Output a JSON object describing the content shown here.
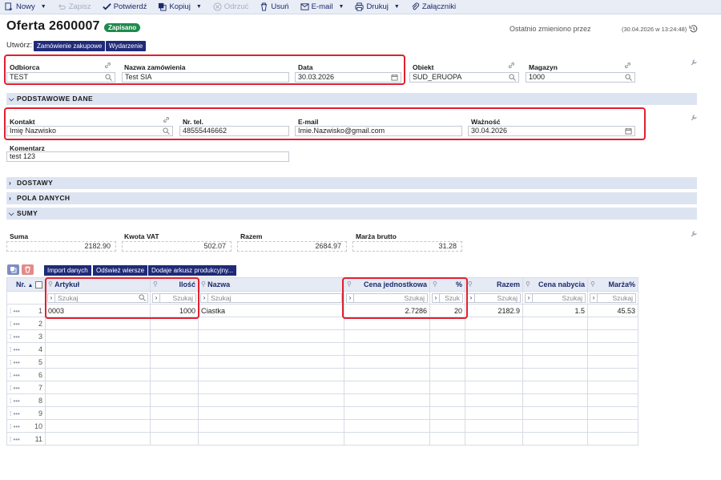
{
  "toolbar": {
    "new": "Nowy",
    "save": "Zapisz",
    "confirm": "Potwierdź",
    "copy": "Kopiuj",
    "reject": "Odrzuć",
    "delete": "Usuń",
    "email": "E-mail",
    "print": "Drukuj",
    "attachments": "Załączniki"
  },
  "header": {
    "title": "Oferta 2600007",
    "status": "Zapisano",
    "last_modified_label": "Ostatnio zmieniono przez",
    "last_modified_date": "(30.04.2026 w 13:24:48)"
  },
  "create": {
    "label": "Utwórz:",
    "purchase_order": "Zamówienie zakupowe",
    "event": "Wydarzenie"
  },
  "fields": {
    "recipient_label": "Odbiorca",
    "recipient_value": "TEST",
    "order_name_label": "Nazwa zamówienia",
    "order_name_value": "Test SIA",
    "date_label": "Data",
    "date_value": "30.03.2026",
    "object_label": "Obiekt",
    "object_value": "SUD_ERUOPA",
    "warehouse_label": "Magazyn",
    "warehouse_value": "1000"
  },
  "sections": {
    "basic": "PODSTAWOWE DANE",
    "deliveries": "DOSTAWY",
    "data_fields": "POLA DANYCH",
    "sums": "SUMY"
  },
  "basic": {
    "contact_label": "Kontakt",
    "contact_value": "Imię Nazwisko",
    "phone_label": "Nr. tel.",
    "phone_value": "48555446662",
    "email_label": "E-mail",
    "email_value": "Imie.Nazwisko@gmail.com",
    "validity_label": "Ważność",
    "validity_value": "30.04.2026",
    "comment_label": "Komentarz",
    "comment_value": "test 123"
  },
  "sums": {
    "sum_label": "Suma",
    "sum_value": "2182.90",
    "vat_label": "Kwota VAT",
    "vat_value": "502.07",
    "total_label": "Razem",
    "total_value": "2684.97",
    "margin_label": "Marża brutto",
    "margin_value": "31.28"
  },
  "grid_buttons": {
    "import": "Import danych",
    "refresh": "Odśwież wiersze",
    "add_sheet": "Dodaje arkusz produkcyjny..."
  },
  "grid": {
    "columns": {
      "nr": "Nr.",
      "article": "Artykuł",
      "qty": "Ilość",
      "name": "Nazwa",
      "unit_price": "Cena jednostkowa",
      "percent": "%",
      "total": "Razem",
      "purchase_price": "Cena nabycia",
      "margin_pct": "Marża%"
    },
    "filter": {
      "search": "Szukaj",
      "search_short": "Szuk"
    },
    "rows": [
      {
        "nr": "1",
        "article": "0003",
        "qty": "1000",
        "name": "Ciastka",
        "unit_price": "2.7286",
        "percent": "20",
        "total": "2182.9",
        "purchase_price": "1.5",
        "margin_pct": "45.53"
      },
      {
        "nr": "2"
      },
      {
        "nr": "3"
      },
      {
        "nr": "4"
      },
      {
        "nr": "5"
      },
      {
        "nr": "6"
      },
      {
        "nr": "7"
      },
      {
        "nr": "8"
      },
      {
        "nr": "9"
      },
      {
        "nr": "10"
      },
      {
        "nr": "11"
      }
    ]
  },
  "colors": {
    "accent": "#1f2a78",
    "status": "#1f8a4c",
    "highlight": "#e02030",
    "section_bg": "#dde4f1"
  }
}
